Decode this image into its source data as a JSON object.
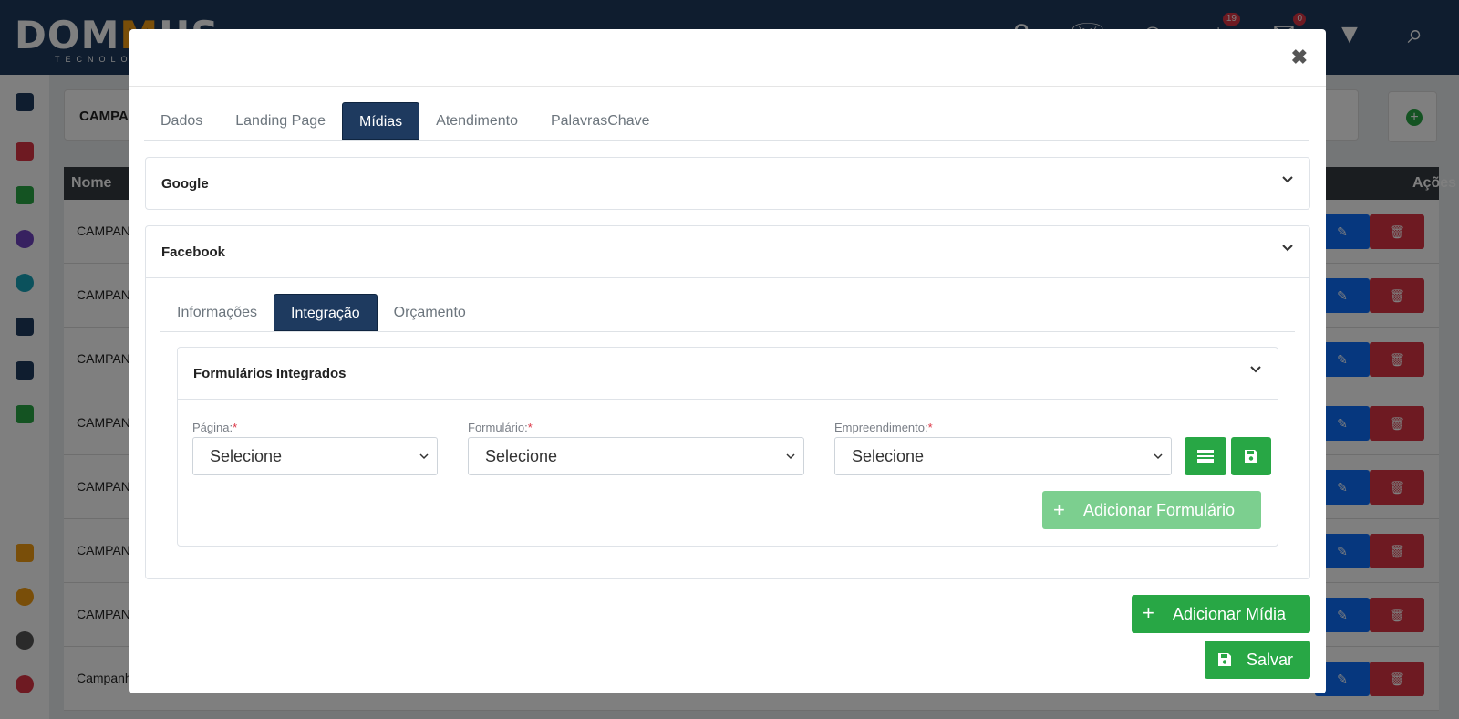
{
  "app": {
    "logo_text_a": "DOM",
    "logo_text_m": "M",
    "logo_text_b": "US",
    "logo_sub": "TECNOLOGIA",
    "badges": [
      "19",
      "0"
    ]
  },
  "background": {
    "header_title": "CAMPANHAS",
    "col_name": "Nome",
    "col_actions": "Ações",
    "rows": [
      "CAMPANHA",
      "CAMPANHA",
      "CAMPANHA",
      "CAMPANHA",
      "CAMPANHA",
      "CAMPANHA",
      "CAMPANHA",
      "Campanha"
    ]
  },
  "modal": {
    "tabs": [
      "Dados",
      "Landing Page",
      "Mídias",
      "Atendimento",
      "PalavrasChave"
    ],
    "active_tab": "Mídias",
    "google_title": "Google",
    "facebook_title": "Facebook",
    "fb_tabs": [
      "Informações",
      "Integração",
      "Orçamento"
    ],
    "fb_active_tab": "Integração",
    "forms_title": "Formulários Integrados",
    "pagina_label": "Página:",
    "formulario_label": "Formulário:",
    "empreendimento_label": "Empreendimento:",
    "required_mark": "*",
    "select_placeholder": "Selecione",
    "add_form_button": "Adicionar Formulário",
    "add_media_button": "Adicionar Mídia",
    "save_button": "Salvar"
  },
  "colors": {
    "primary": "#1e3a5f",
    "success": "#28a745",
    "danger": "#dc3545"
  }
}
